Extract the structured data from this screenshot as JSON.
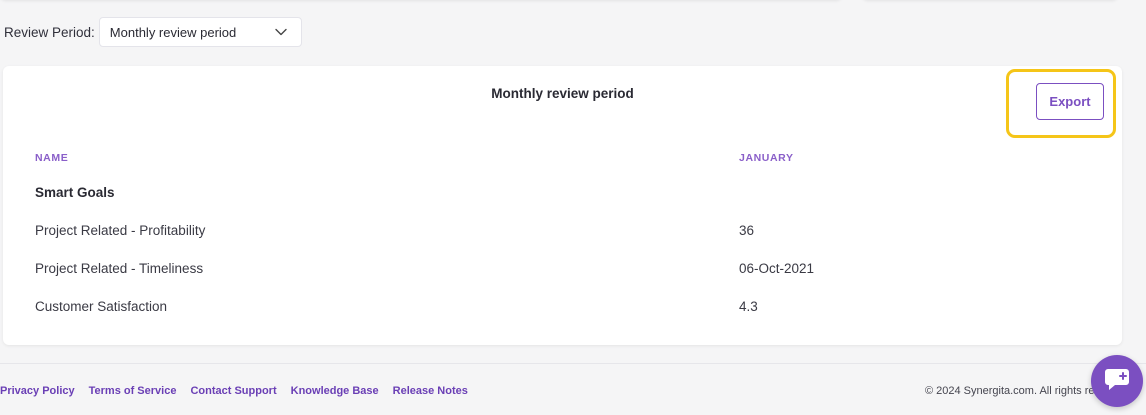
{
  "review_period": {
    "label": "Review Period:",
    "selected": "Monthly review period"
  },
  "report": {
    "title": "Monthly review period",
    "export_label": "Export",
    "columns": [
      "NAME",
      "JANUARY"
    ],
    "group_title": "Smart Goals",
    "rows": [
      {
        "name": "Project Related - Profitability",
        "january": "36"
      },
      {
        "name": "Project Related - Timeliness",
        "january": "06-Oct-2021"
      },
      {
        "name": "Customer Satisfaction",
        "january": "4.3"
      }
    ]
  },
  "footer": {
    "links": [
      "Privacy Policy",
      "Terms of Service",
      "Contact Support",
      "Knowledge Base",
      "Release Notes"
    ],
    "copyright": "© 2024 Synergita.com. All rights res"
  },
  "icons": {
    "select_chevron": "chevron-down-icon",
    "chat": "chat-icon"
  },
  "colors": {
    "accent": "#7b4fc1",
    "highlight": "#f5c518",
    "column_header": "#8a5fc9",
    "background": "#f5f5f6"
  }
}
